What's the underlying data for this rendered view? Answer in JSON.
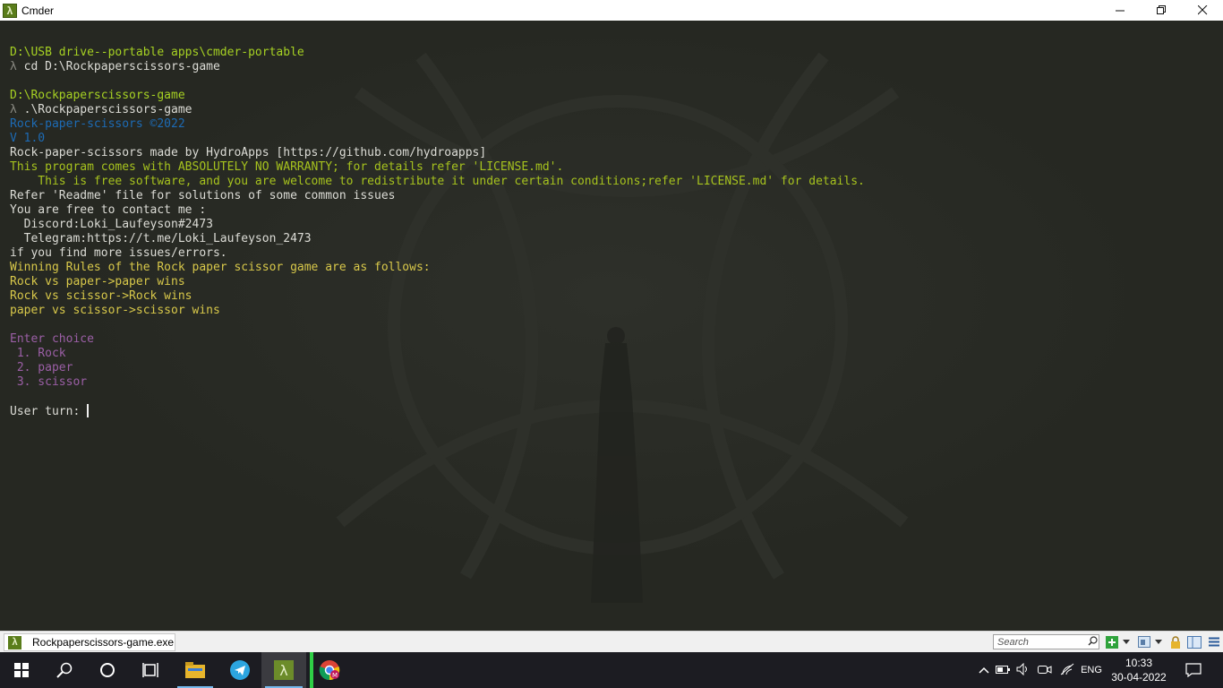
{
  "window": {
    "title": "Cmder",
    "minimize_icon": "minimize-icon",
    "maximize_icon": "restore-icon",
    "close_icon": "close-icon"
  },
  "console": {
    "lines": [
      {
        "text": "D:\\USB drive--portable apps\\cmder-portable",
        "color": "green"
      },
      {
        "prompt": "λ",
        "text": " cd D:\\Rockpaperscissors-game",
        "color": "white"
      },
      {
        "text": "",
        "color": "white"
      },
      {
        "text": "D:\\Rockpaperscissors-game",
        "color": "green"
      },
      {
        "prompt": "λ",
        "text": " .\\Rockpaperscissors-game",
        "color": "white"
      },
      {
        "text": "Rock-paper-scissors ©2022",
        "color": "blue"
      },
      {
        "text": "V 1.0",
        "color": "blue"
      },
      {
        "text": "Rock-paper-scissors made by HydroApps [https://github.com/hydroapps]",
        "color": "white"
      },
      {
        "text": "This program comes with ABSOLUTELY NO WARRANTY; for details refer 'LICENSE.md'.",
        "color": "olive"
      },
      {
        "text": "    This is free software, and you are welcome to redistribute it under certain conditions;refer 'LICENSE.md' for details.",
        "color": "olive"
      },
      {
        "text": "Refer 'Readme' file for solutions of some common issues",
        "color": "white"
      },
      {
        "text": "You are free to contact me :",
        "color": "white"
      },
      {
        "text": "  Discord:Loki_Laufeyson#2473",
        "color": "white"
      },
      {
        "text": "  Telegram:https://t.me/Loki_Laufeyson_2473",
        "color": "white"
      },
      {
        "text": "if you find more issues/errors.",
        "color": "white"
      },
      {
        "text": "Winning Rules of the Rock paper scissor game are as follows:",
        "color": "yellow"
      },
      {
        "text": "Rock vs paper->paper wins",
        "color": "yellow"
      },
      {
        "text": "Rock vs scissor->Rock wins",
        "color": "yellow"
      },
      {
        "text": "paper vs scissor->scissor wins",
        "color": "yellow"
      },
      {
        "text": "",
        "color": "white"
      },
      {
        "text": "Enter choice",
        "color": "purple"
      },
      {
        "text": " 1. Rock",
        "color": "purple"
      },
      {
        "text": " 2. paper",
        "color": "purple"
      },
      {
        "text": " 3. scissor",
        "color": "purple"
      },
      {
        "text": "",
        "color": "white"
      },
      {
        "text": "User turn: ",
        "color": "white",
        "cursor": true
      }
    ]
  },
  "tabbar": {
    "tab_label": "Rockpaperscissors-game.exe",
    "search_placeholder": "Search"
  },
  "taskbar": {
    "apps": [
      "start",
      "search",
      "cortana",
      "task-view",
      "file-explorer",
      "telegram",
      "cmder",
      "chrome"
    ],
    "language": "ENG",
    "time": "10:33",
    "date": "30-04-2022"
  },
  "colors": {
    "green": "#a6d123",
    "white": "#dcdcd6",
    "gray": "#8a8a82",
    "blue": "#1d6bb5",
    "olive": "#a6c21e",
    "yellow": "#d8c84a",
    "purple": "#9b5fa6"
  }
}
